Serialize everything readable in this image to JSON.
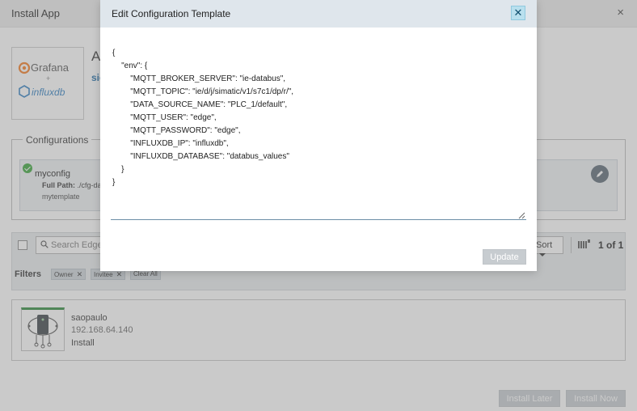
{
  "background": {
    "title": "Install App",
    "close_glyph": "×",
    "app_name_fragment": "A",
    "app_sub_fragment": "sie",
    "logo": {
      "brand1": "Grafana",
      "plus": "+",
      "brand2": "influxdb"
    },
    "configurations": {
      "legend": "Configurations",
      "item": {
        "name": "myconfig",
        "path_label": "Full Path:",
        "path_value": "./cfg-da",
        "template": "mytemplate"
      }
    },
    "toolbar": {
      "search_placeholder": "Search Edge",
      "sort_label": "Sort",
      "page_indicator": "1 of 1",
      "filters_label": "Filters",
      "chips": [
        "Owner",
        "Invitee"
      ],
      "clear_all": "Clear All",
      "chip_close_glyph": "✕"
    },
    "device": {
      "name": "saopaulo",
      "ip": "192.168.64.140",
      "status": "Install"
    },
    "buttons": {
      "install_later": "Install Later",
      "install_now": "Install Now"
    }
  },
  "modal": {
    "title": "Edit Configuration Template",
    "close_glyph": "✕",
    "json_text": "{\n    \"env\": {\n        \"MQTT_BROKER_SERVER\": \"ie-databus\",\n        \"MQTT_TOPIC\": \"ie/d/j/simatic/v1/s7c1/dp/r/\",\n        \"DATA_SOURCE_NAME\": \"PLC_1/default\",\n        \"MQTT_USER\": \"edge\",\n        \"MQTT_PASSWORD\": \"edge\",\n        \"INFLUXDB_IP\": \"influxdb\",\n        \"INFLUXDB_DATABASE\": \"databus_values\"\n    }\n}",
    "update_label": "Update"
  },
  "colors": {
    "accent_green": "#3aa63a",
    "modal_header": "#dfe6ec",
    "close_highlight": "#b9e0ee",
    "disabled_button": "#c7ccd0",
    "link_blue": "#1a6aa5"
  },
  "icons": {
    "close": "close-icon",
    "check": "check-circle-icon",
    "edit": "pencil-icon",
    "search": "search-icon",
    "sort": "chevron-down-icon",
    "view": "grid-view-icon",
    "device": "edge-device-icon",
    "resize": "resize-grip-icon"
  }
}
